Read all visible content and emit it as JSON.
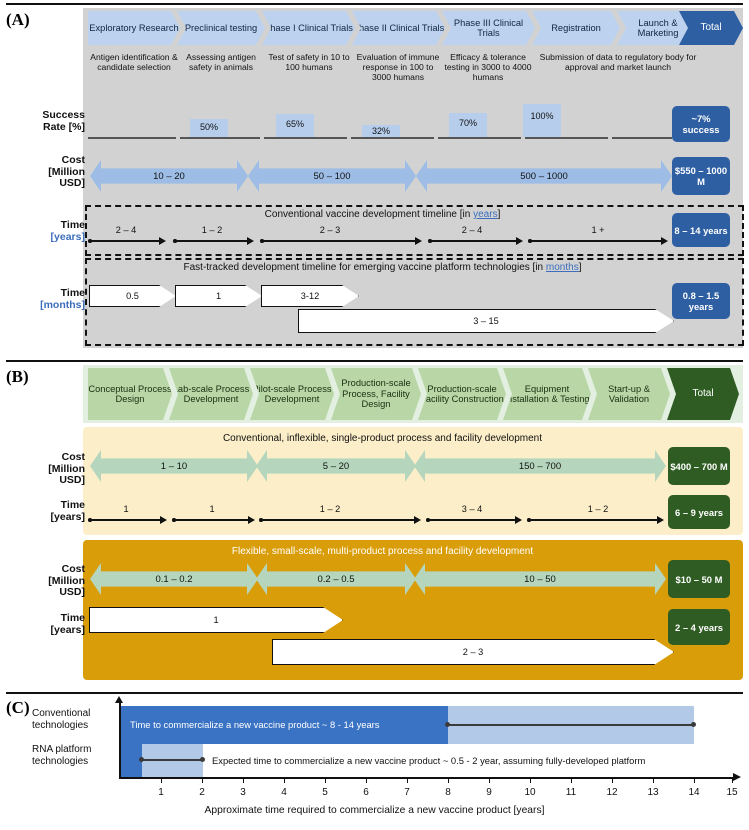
{
  "figure": {
    "panel_a_label": "(A)",
    "panel_b_label": "(B)",
    "panel_c_label": "(C)"
  },
  "colors": {
    "panel_a_bg": "#d2d2d2",
    "stage_blue": "#bcd2ee",
    "total_blue": "#2e5fa3",
    "bar_blue": "#b6cdec",
    "arrow_blue": "#9dbde6",
    "panel_b_header_bg": "#e3efe0",
    "stage_green": "#b8d6a6",
    "total_green": "#2f5c23",
    "cream_bg": "#fbeec8",
    "gold_bg": "#d99d09",
    "arrow_green": "#b5d6bd",
    "c_dark_blue": "#3a72c4",
    "c_light_blue": "#b2c9e8"
  },
  "panelA": {
    "stages": [
      {
        "title": "Exploratory Research",
        "desc": "Antigen identification & candidate selection"
      },
      {
        "title": "Preclinical testing",
        "desc": "Assessing antigen safety in animals"
      },
      {
        "title": "Phase I Clinical Trials",
        "desc": "Test of safety in 10 to 100 humans"
      },
      {
        "title": "Phase II Clinical Trials",
        "desc": "Evaluation of immune response in 100 to 3000 humans"
      },
      {
        "title": "Phase III Clinical Trials",
        "desc": "Efficacy & tolerance testing in 3000 to 4000 humans"
      },
      {
        "title": "Registration",
        "desc": ""
      },
      {
        "title": "Launch & Marketing",
        "desc": ""
      }
    ],
    "shared_desc": "Submission of data to regulatory body for approval and market launch",
    "total_header": "Total",
    "rows": {
      "success": {
        "label_line1": "Success",
        "label_line2": "Rate [%]",
        "values": [
          "",
          "50%",
          "65%",
          "32%",
          "70%",
          "100%",
          ""
        ],
        "percents": [
          0,
          50,
          65,
          32,
          70,
          100,
          0
        ],
        "total": "~7% success"
      },
      "cost": {
        "label_line1": "Cost",
        "label_line2": "[Million",
        "label_line3": "USD]",
        "arrows": [
          "10 – 20",
          "50 – 100",
          "500 – 1000"
        ],
        "total": "$550 – 1000 M"
      },
      "time_years": {
        "banner_pre": "Conventional vaccine development timeline [in ",
        "banner_link": "years",
        "banner_post": "]",
        "label_line1": "Time",
        "label_line2": "[years]",
        "values": [
          "2 – 4",
          "1 – 2",
          "2 – 3",
          "2 – 4",
          "1 +"
        ],
        "total": "8 – 14 years"
      },
      "time_months": {
        "banner_pre": "Fast-tracked  development timeline for emerging vaccine platform technologies [in ",
        "banner_link": "months",
        "banner_post": "]",
        "label_line1": "Time",
        "label_line2": "[months]",
        "values": [
          "0.5",
          "1",
          "3-12",
          "3 – 15"
        ],
        "total": "0.8 – 1.5 years"
      }
    }
  },
  "panelB": {
    "stages": [
      {
        "title": "Conceptual Process Design"
      },
      {
        "title": "Lab-scale Process Development"
      },
      {
        "title": "Pilot-scale Process Development"
      },
      {
        "title": "Production-scale Process, Facility Design"
      },
      {
        "title": "Production-scale Facility Construction"
      },
      {
        "title": "Equipment Installation & Testing"
      },
      {
        "title": "Start-up & Validation"
      }
    ],
    "total_header": "Total",
    "conventional": {
      "banner": "Conventional, inflexible, single-product process and facility development",
      "cost": {
        "label_line1": "Cost",
        "label_line2": "[Million",
        "label_line3": "USD]",
        "arrows": [
          "1 – 10",
          "5 – 20",
          "150 – 700"
        ],
        "total": "$400 – 700 M"
      },
      "time": {
        "label_line1": "Time",
        "label_line2": "[years]",
        "values": [
          "1",
          "1",
          "1 – 2",
          "3 – 4",
          "1 – 2"
        ],
        "total": "6 – 9 years"
      }
    },
    "flexible": {
      "banner": "Flexible, small-scale, multi-product process and facility development",
      "cost": {
        "label_line1": "Cost",
        "label_line2": "[Million",
        "label_line3": "USD]",
        "arrows": [
          "0.1 – 0.2",
          "0.2 – 0.5",
          "10 – 50"
        ],
        "total": "$10 – 50 M"
      },
      "time": {
        "label_line1": "Time",
        "label_line2": "[years]",
        "values": [
          "1",
          "2 – 3"
        ],
        "total": "2 – 4 years"
      }
    }
  },
  "chart_data": {
    "type": "bar",
    "title": "",
    "xlabel": "Approximate time required to commercialize a new vaccine product [years]",
    "ylabel": "",
    "xlim": [
      0,
      15
    ],
    "xticks": [
      1,
      2,
      3,
      4,
      5,
      6,
      7,
      8,
      9,
      10,
      11,
      12,
      13,
      14,
      15
    ],
    "grid": false,
    "legend": "none",
    "orientation": "horizontal",
    "categories": [
      "Conventional technologies",
      "RNA platform technologies"
    ],
    "series": [
      {
        "name": "Lower bound (dark blue)",
        "values": [
          8,
          0.5
        ]
      },
      {
        "name": "Upper bound (light blue)",
        "values": [
          14,
          2
        ]
      }
    ],
    "annotations": [
      "Time to commercialize a new vaccine product ~ 8 - 14 years",
      "Expected time to commercialize a new vaccine product ~ 0.5 - 2 year, assuming fully-developed platform"
    ]
  }
}
